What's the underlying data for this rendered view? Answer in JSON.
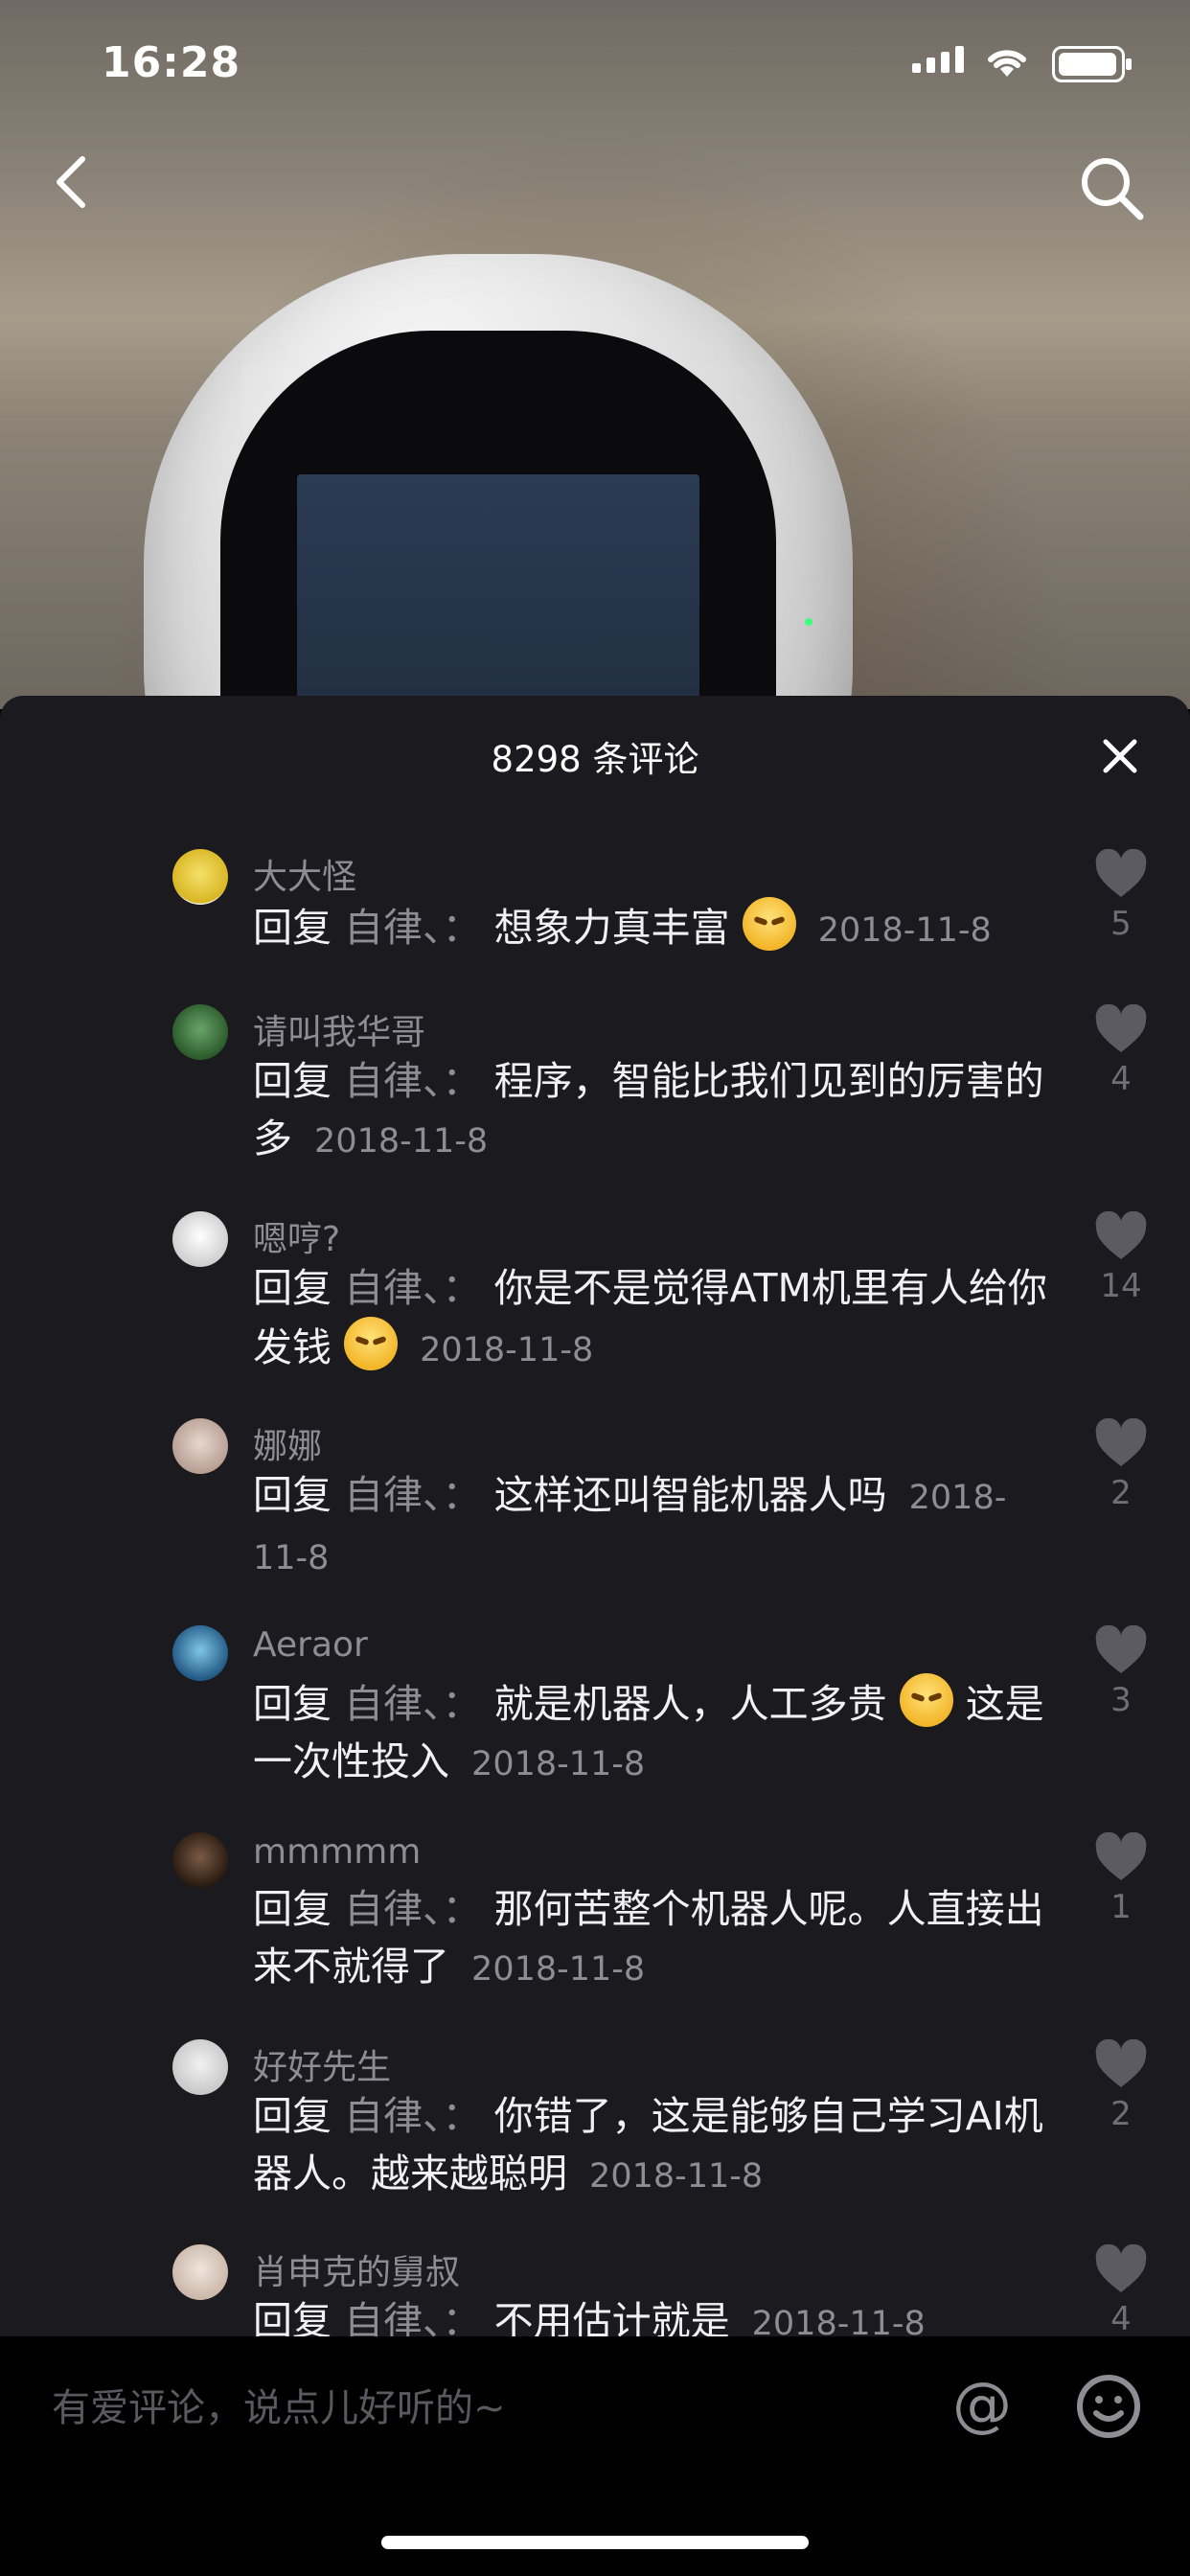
{
  "status_bar": {
    "time": "16:28"
  },
  "nav": {
    "back_icon": "chevron-left-icon",
    "search_icon": "search-icon"
  },
  "panel": {
    "title": "8298 条评论"
  },
  "comments": [
    {
      "username": "大大怪",
      "reply_prefix": "回复",
      "reply_target": "自律、：",
      "text": "想象力真丰富",
      "emoji": "laughing-face",
      "date": "2018-11-8",
      "likes": "5"
    },
    {
      "username": "请叫我华哥",
      "reply_prefix": "回复",
      "reply_target": "自律、：",
      "text": "程序，智能比我们见到的厉害的多",
      "date": "2018-11-8",
      "likes": "4"
    },
    {
      "username": "嗯哼?",
      "reply_prefix": "回复",
      "reply_target": "自律、：",
      "text": "你是不是觉得ATM机里有人给你发钱",
      "emoji": "laughing-face",
      "date": "2018-11-8",
      "likes": "14"
    },
    {
      "username": "娜娜",
      "reply_prefix": "回复",
      "reply_target": "自律、：",
      "text": "这样还叫智能机器人吗",
      "date": "2018-11-8",
      "likes": "2"
    },
    {
      "username": "Aeraor",
      "reply_prefix": "回复",
      "reply_target": "自律、：",
      "text": "就是机器人，人工多贵",
      "emoji": "shush-face",
      "text2": "这是一次性投入",
      "date": "2018-11-8",
      "likes": "3"
    },
    {
      "username": "mmmmm",
      "reply_prefix": "回复",
      "reply_target": "自律、：",
      "text": "那何苦整个机器人呢。人直接出来不就得了",
      "date": "2018-11-8",
      "likes": "1"
    },
    {
      "username": "好好先生",
      "reply_prefix": "回复",
      "reply_target": "自律、：",
      "text": "你错了，这是能够自己学习AI机器人。越来越聪明",
      "date": "2018-11-8",
      "likes": "2"
    },
    {
      "username": "肖申克的舅叔",
      "reply_prefix": "回复",
      "reply_target": "自律、：",
      "text": "不用估计就是",
      "date": "2018-11-8",
      "likes": "4"
    }
  ],
  "input": {
    "placeholder": "有爱评论，说点儿好听的~",
    "at_label": "@"
  },
  "colors": {
    "panel_bg": "#1b1a1e",
    "muted_text": "#8e8d93",
    "like_gray": "#6f6e74"
  }
}
